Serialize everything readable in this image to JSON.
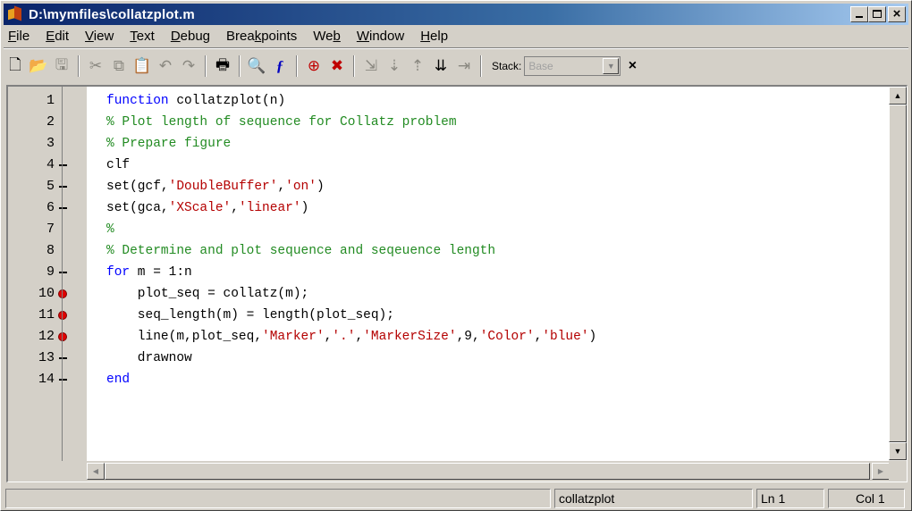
{
  "window": {
    "title": "D:\\mymfiles\\collatzplot.m",
    "buttons": {
      "minimize": "_",
      "maximize": "□",
      "close": "×"
    }
  },
  "menu": [
    {
      "label": "File",
      "mnemonic": "F",
      "rest": "ile"
    },
    {
      "label": "Edit",
      "mnemonic": "E",
      "rest": "dit"
    },
    {
      "label": "View",
      "mnemonic": "V",
      "rest": "iew"
    },
    {
      "label": "Text",
      "mnemonic": "T",
      "rest": "ext"
    },
    {
      "label": "Debug",
      "mnemonic": "D",
      "rest": "ebug"
    },
    {
      "label": "Breakpoints",
      "pre": "Brea",
      "mnemonic": "k",
      "rest": "points"
    },
    {
      "label": "Web",
      "pre": "We",
      "mnemonic": "b",
      "rest": ""
    },
    {
      "label": "Window",
      "mnemonic": "W",
      "rest": "indow"
    },
    {
      "label": "Help",
      "mnemonic": "H",
      "rest": "elp"
    }
  ],
  "toolbar": {
    "icons": [
      "new-file-icon",
      "open-file-icon",
      "save-icon",
      "cut-icon",
      "copy-icon",
      "paste-icon",
      "undo-icon",
      "redo-icon",
      "print-icon",
      "find-icon",
      "function-icon",
      "set-breakpoint-icon",
      "clear-breakpoints-icon",
      "step-icon",
      "step-in-icon",
      "step-out-icon",
      "continue-icon",
      "exit-debug-icon"
    ],
    "stack_label": "Stack:",
    "stack_value": "Base"
  },
  "editor": {
    "lines": [
      {
        "num": "1",
        "marker": "none",
        "tokens": [
          {
            "t": "function",
            "c": "kw"
          },
          {
            "t": " collatzplot(n)",
            "c": ""
          }
        ]
      },
      {
        "num": "2",
        "marker": "none",
        "tokens": [
          {
            "t": "% Plot length of sequence for Collatz problem",
            "c": "cm"
          }
        ]
      },
      {
        "num": "3",
        "marker": "none",
        "tokens": [
          {
            "t": "% Prepare figure",
            "c": "cm"
          }
        ]
      },
      {
        "num": "4",
        "marker": "dash",
        "tokens": [
          {
            "t": "clf",
            "c": ""
          }
        ]
      },
      {
        "num": "5",
        "marker": "dash",
        "tokens": [
          {
            "t": "set(gcf,",
            "c": ""
          },
          {
            "t": "'DoubleBuffer'",
            "c": "st"
          },
          {
            "t": ",",
            "c": ""
          },
          {
            "t": "'on'",
            "c": "st"
          },
          {
            "t": ")",
            "c": ""
          }
        ]
      },
      {
        "num": "6",
        "marker": "dash",
        "tokens": [
          {
            "t": "set(gca,",
            "c": ""
          },
          {
            "t": "'XScale'",
            "c": "st"
          },
          {
            "t": ",",
            "c": ""
          },
          {
            "t": "'linear'",
            "c": "st"
          },
          {
            "t": ")",
            "c": ""
          }
        ]
      },
      {
        "num": "7",
        "marker": "none",
        "tokens": [
          {
            "t": "%",
            "c": "cm"
          }
        ]
      },
      {
        "num": "8",
        "marker": "none",
        "tokens": [
          {
            "t": "% Determine and plot sequence and seqeuence length",
            "c": "cm"
          }
        ]
      },
      {
        "num": "9",
        "marker": "dash",
        "tokens": [
          {
            "t": "for",
            "c": "kw"
          },
          {
            "t": " m = 1:n",
            "c": ""
          }
        ]
      },
      {
        "num": "10",
        "marker": "breakpoint",
        "tokens": [
          {
            "t": "    plot_seq = collatz(m);",
            "c": ""
          }
        ]
      },
      {
        "num": "11",
        "marker": "breakpoint",
        "tokens": [
          {
            "t": "    seq_length(m) = length(plot_seq);",
            "c": ""
          }
        ]
      },
      {
        "num": "12",
        "marker": "breakpoint",
        "tokens": [
          {
            "t": "    line(m,plot_seq,",
            "c": ""
          },
          {
            "t": "'Marker'",
            "c": "st"
          },
          {
            "t": ",",
            "c": ""
          },
          {
            "t": "'.'",
            "c": "st"
          },
          {
            "t": ",",
            "c": ""
          },
          {
            "t": "'MarkerSize'",
            "c": "st"
          },
          {
            "t": ",9,",
            "c": ""
          },
          {
            "t": "'Color'",
            "c": "st"
          },
          {
            "t": ",",
            "c": ""
          },
          {
            "t": "'blue'",
            "c": "st"
          },
          {
            "t": ")",
            "c": ""
          }
        ]
      },
      {
        "num": "13",
        "marker": "dash",
        "tokens": [
          {
            "t": "    drawnow",
            "c": ""
          }
        ]
      },
      {
        "num": "14",
        "marker": "dash",
        "tokens": [
          {
            "t": "end",
            "c": "kw"
          }
        ]
      }
    ]
  },
  "status": {
    "function_name": "collatzplot",
    "line": "Ln 1",
    "column": "Col 1"
  },
  "colors": {
    "keyword": "#0000ff",
    "comment": "#228b22",
    "string": "#b40000",
    "breakpoint": "#e00000",
    "titlebar": "#0a246a"
  }
}
